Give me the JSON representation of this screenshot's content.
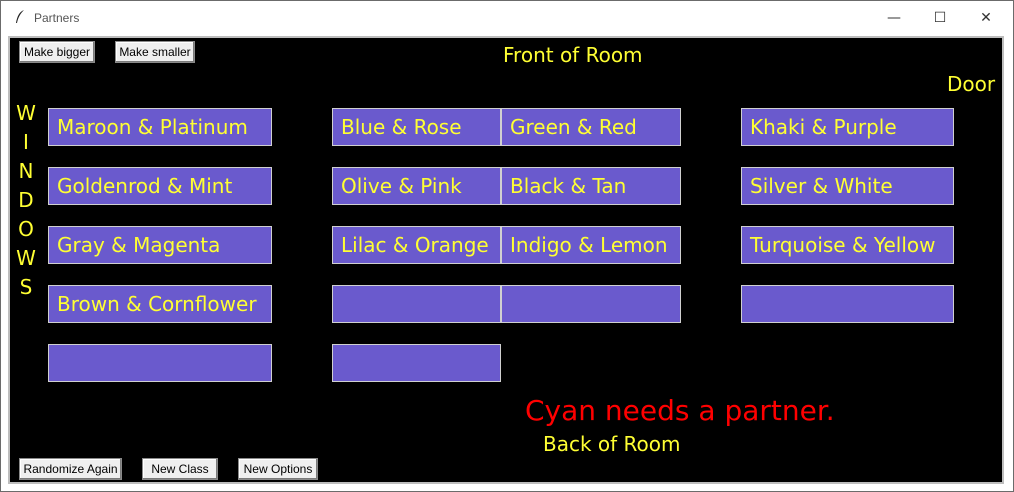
{
  "window": {
    "title": "Partners",
    "minimize_glyph": "—",
    "maximize_glyph": "☐",
    "close_glyph": "✕"
  },
  "buttons": {
    "make_bigger": "Make bigger",
    "make_smaller": "Make smaller",
    "randomize": "Randomize Again",
    "new_class": "New Class",
    "new_options": "New Options"
  },
  "labels": {
    "front": "Front of Room",
    "back": "Back of Room",
    "door": "Door",
    "windows": [
      "W",
      "I",
      "N",
      "D",
      "O",
      "W",
      "S"
    ]
  },
  "message": "Cyan needs a partner.",
  "seats": {
    "col1": [
      "Maroon & Platinum",
      "Goldenrod & Mint",
      "Gray & Magenta",
      "Brown & Cornflower",
      ""
    ],
    "col2": [
      "Blue & Rose",
      "Olive & Pink",
      "Lilac & Orange",
      "",
      ""
    ],
    "col3": [
      "Green & Red",
      "Black & Tan",
      "Indigo & Lemon",
      ""
    ],
    "col4": [
      "Khaki & Purple",
      "Silver & White",
      "Turquoise & Yellow",
      ""
    ]
  },
  "colors": {
    "seat_fill": "#6a5acd",
    "text": "#ffff33",
    "alert": "#ff0000",
    "background": "#000000"
  }
}
